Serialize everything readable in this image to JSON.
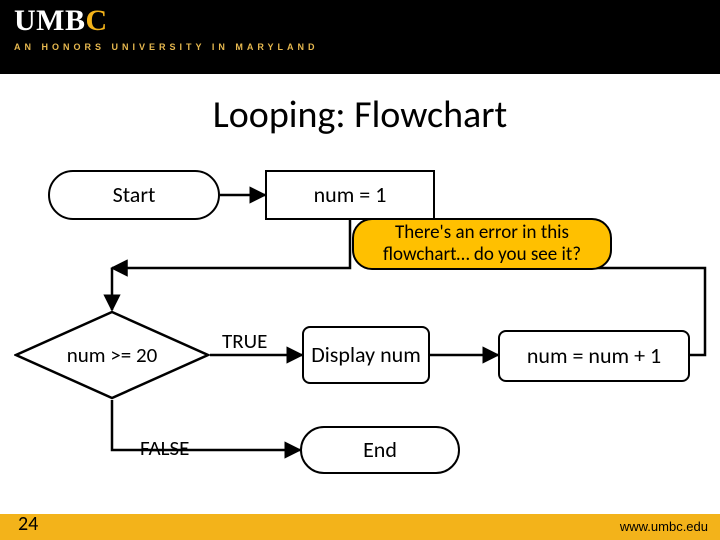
{
  "header": {
    "logo_prefix": "UMB",
    "logo_suffix": "C",
    "tagline": "AN HONORS UNIVERSITY IN MARYLAND"
  },
  "title": "Looping: Flowchart",
  "nodes": {
    "start": "Start",
    "init": "num = 1",
    "decision": "num >= 20",
    "display": "Display num",
    "increment": "num = num + 1",
    "end": "End"
  },
  "edges": {
    "true_label": "TRUE",
    "false_label": "FALSE"
  },
  "callout": "There's an error in this flowchart… do you see it?",
  "footer": {
    "page": "24",
    "url": "www.umbc.edu"
  }
}
